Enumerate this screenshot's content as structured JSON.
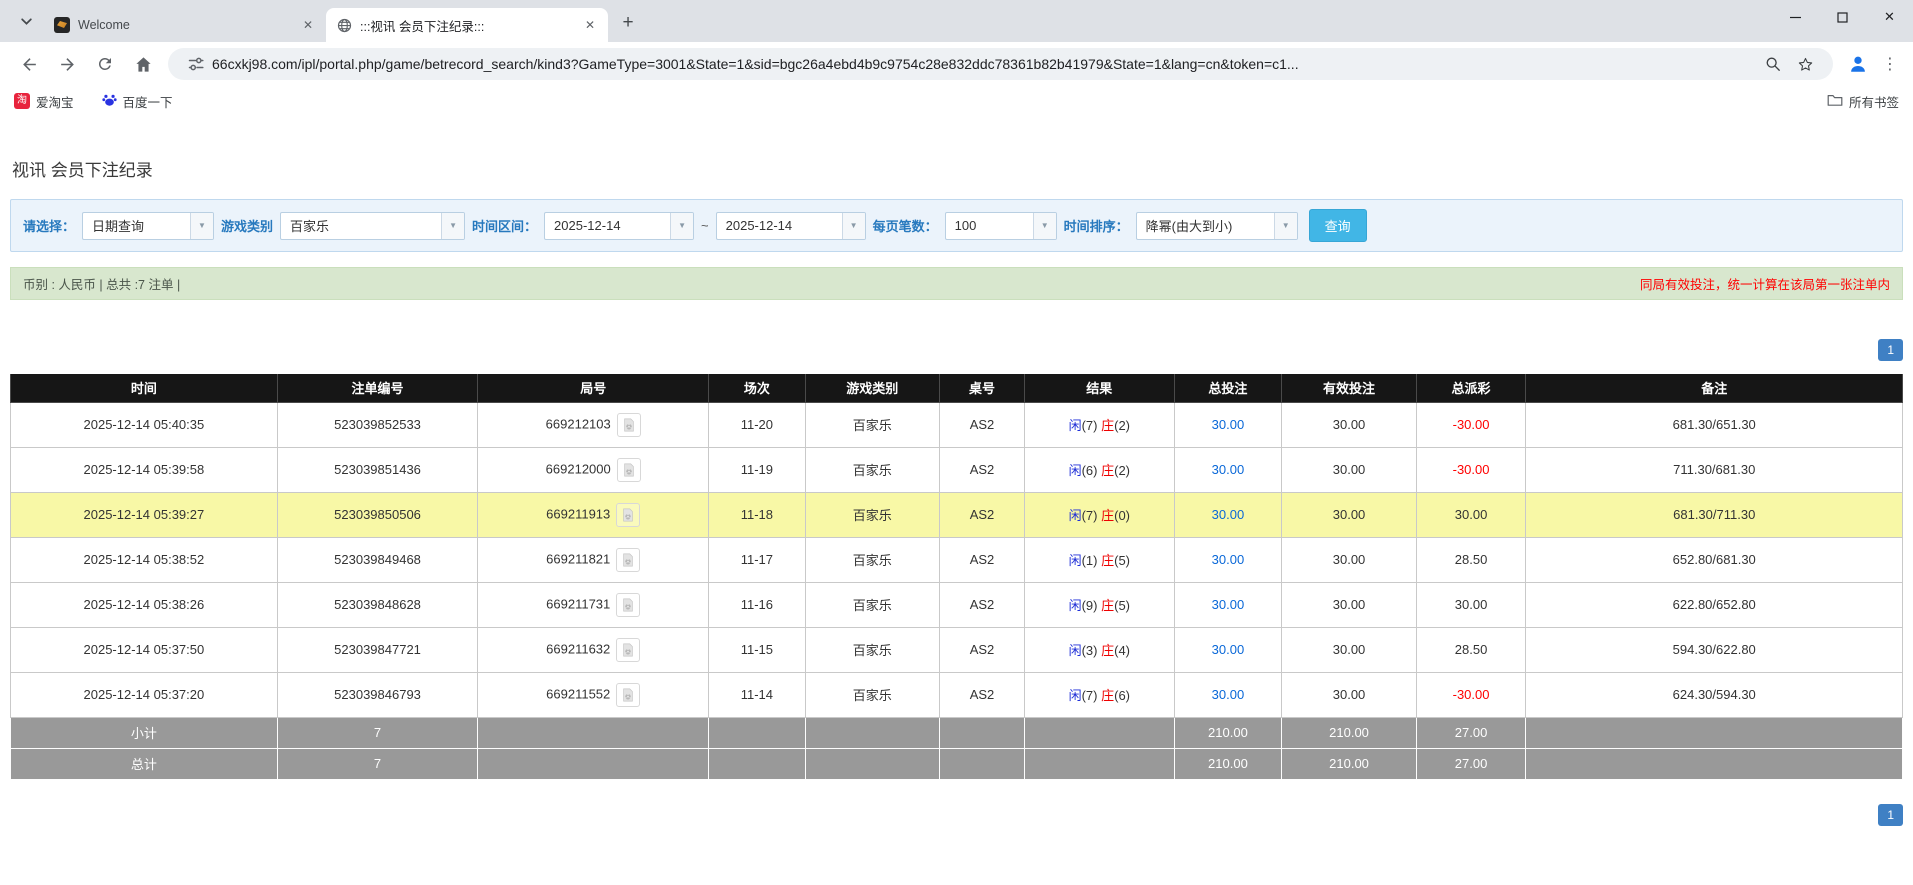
{
  "icons": {
    "close": "✕",
    "plus": "+",
    "dots": "⋮",
    "dropdown": "▼",
    "taobao_glyph": "淘"
  },
  "browser": {
    "tabs": [
      {
        "title": "Welcome"
      },
      {
        "title": ":::视讯 会员下注纪录:::"
      }
    ],
    "url": "66cxkj98.com/ipl/portal.php/game/betrecord_search/kind3?GameType=3001&State=1&sid=bgc26a4ebd4b9c9754c28e832ddc78361b82b41979&State=1&lang=cn&token=c1...",
    "bookmarks": [
      "爱淘宝",
      "百度一下"
    ],
    "all_bookmarks_label": "所有书签"
  },
  "page": {
    "title": "视讯 会员下注纪录",
    "filters": {
      "select_label": "请选择：",
      "select_value": "日期查询",
      "game_type_label": "游戏类别",
      "game_type_value": "百家乐",
      "date_range_label": "时间区间：",
      "date_from": "2025-12-14",
      "tilde": "~",
      "date_to": "2025-12-14",
      "per_page_label": "每页笔数：",
      "per_page_value": "100",
      "sort_label": "时间排序：",
      "sort_value": "降幂(由大到小)",
      "search_button": "查询"
    },
    "info_bar": {
      "left": "币别 : 人民币 | 总共 :7 注单 |",
      "right": "同局有效投注，统一计算在该局第一张注单内"
    },
    "pagination": "1",
    "table": {
      "headers": [
        "时间",
        "注单编号",
        "局号",
        "场次",
        "游戏类别",
        "桌号",
        "结果",
        "总投注",
        "有效投注",
        "总派彩",
        "备注"
      ],
      "rows": [
        {
          "time": "2025-12-14 05:40:35",
          "bet_id": "523039852533",
          "round": "669212103",
          "session": "11-20",
          "game": "百家乐",
          "table": "AS2",
          "result": {
            "p": "闲",
            "pn": "(7)",
            "b": "庄",
            "bn": "(2)"
          },
          "total_bet": "30.00",
          "valid_bet": "30.00",
          "payout": "-30.00",
          "payout_neg": true,
          "remark": "681.30/651.30",
          "highlight": false
        },
        {
          "time": "2025-12-14 05:39:58",
          "bet_id": "523039851436",
          "round": "669212000",
          "session": "11-19",
          "game": "百家乐",
          "table": "AS2",
          "result": {
            "p": "闲",
            "pn": "(6)",
            "b": "庄",
            "bn": "(2)"
          },
          "total_bet": "30.00",
          "valid_bet": "30.00",
          "payout": "-30.00",
          "payout_neg": true,
          "remark": "711.30/681.30",
          "highlight": false
        },
        {
          "time": "2025-12-14 05:39:27",
          "bet_id": "523039850506",
          "round": "669211913",
          "session": "11-18",
          "game": "百家乐",
          "table": "AS2",
          "result": {
            "p": "闲",
            "pn": "(7)",
            "b": "庄",
            "bn": "(0)"
          },
          "total_bet": "30.00",
          "valid_bet": "30.00",
          "payout": "30.00",
          "payout_neg": false,
          "remark": "681.30/711.30",
          "highlight": true
        },
        {
          "time": "2025-12-14 05:38:52",
          "bet_id": "523039849468",
          "round": "669211821",
          "session": "11-17",
          "game": "百家乐",
          "table": "AS2",
          "result": {
            "p": "闲",
            "pn": "(1)",
            "b": "庄",
            "bn": "(5)"
          },
          "total_bet": "30.00",
          "valid_bet": "30.00",
          "payout": "28.50",
          "payout_neg": false,
          "remark": "652.80/681.30",
          "highlight": false
        },
        {
          "time": "2025-12-14 05:38:26",
          "bet_id": "523039848628",
          "round": "669211731",
          "session": "11-16",
          "game": "百家乐",
          "table": "AS2",
          "result": {
            "p": "闲",
            "pn": "(9)",
            "b": "庄",
            "bn": "(5)"
          },
          "total_bet": "30.00",
          "valid_bet": "30.00",
          "payout": "30.00",
          "payout_neg": false,
          "remark": "622.80/652.80",
          "highlight": false
        },
        {
          "time": "2025-12-14 05:37:50",
          "bet_id": "523039847721",
          "round": "669211632",
          "session": "11-15",
          "game": "百家乐",
          "table": "AS2",
          "result": {
            "p": "闲",
            "pn": "(3)",
            "b": "庄",
            "bn": "(4)"
          },
          "total_bet": "30.00",
          "valid_bet": "30.00",
          "payout": "28.50",
          "payout_neg": false,
          "remark": "594.30/622.80",
          "highlight": false
        },
        {
          "time": "2025-12-14 05:37:20",
          "bet_id": "523039846793",
          "round": "669211552",
          "session": "11-14",
          "game": "百家乐",
          "table": "AS2",
          "result": {
            "p": "闲",
            "pn": "(7)",
            "b": "庄",
            "bn": "(6)"
          },
          "total_bet": "30.00",
          "valid_bet": "30.00",
          "payout": "-30.00",
          "payout_neg": true,
          "remark": "624.30/594.30",
          "highlight": false
        }
      ],
      "footer_rows": [
        {
          "label": "小计",
          "count": "7",
          "total_bet": "210.00",
          "valid_bet": "210.00",
          "payout": "27.00"
        },
        {
          "label": "总计",
          "count": "7",
          "total_bet": "210.00",
          "valid_bet": "210.00",
          "payout": "27.00"
        }
      ]
    }
  }
}
